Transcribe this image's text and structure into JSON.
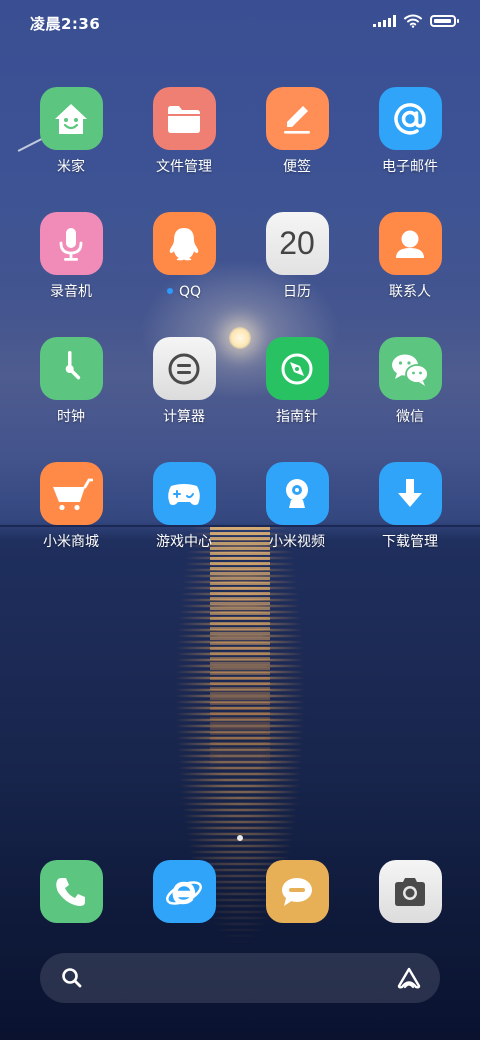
{
  "status_bar": {
    "time": "凌晨2:36",
    "battery_level": 0.95
  },
  "home_screen": {
    "rows": [
      [
        {
          "name": "app-mi-home",
          "label": "米家",
          "color": "#5cc680",
          "icon": "home-smile-icon"
        },
        {
          "name": "app-file-manager",
          "label": "文件管理",
          "color": "#ef7f72",
          "icon": "folder-icon"
        },
        {
          "name": "app-notes",
          "label": "便签",
          "color": "#ff8e57",
          "icon": "pencil-icon"
        },
        {
          "name": "app-email",
          "label": "电子邮件",
          "color": "#2fa4f9",
          "icon": "at-sign-icon"
        }
      ],
      [
        {
          "name": "app-recorder",
          "label": "录音机",
          "color": "#f08cb7",
          "icon": "microphone-icon"
        },
        {
          "name": "app-qq",
          "label": "QQ",
          "color": "#ff8a48",
          "icon": "penguin-icon",
          "notification_dot": true
        },
        {
          "name": "app-calendar",
          "label": "日历",
          "color": "#eeeeee",
          "icon": "calendar-icon",
          "icon_text": "20"
        },
        {
          "name": "app-contacts",
          "label": "联系人",
          "color": "#ff8a48",
          "icon": "person-icon"
        }
      ],
      [
        {
          "name": "app-clock",
          "label": "时钟",
          "color": "#5cc680",
          "icon": "clock-icon"
        },
        {
          "name": "app-calculator",
          "label": "计算器",
          "color": "#ececec",
          "icon": "equals-icon"
        },
        {
          "name": "app-compass",
          "label": "指南针",
          "color": "#28c263",
          "icon": "compass-icon"
        },
        {
          "name": "app-wechat",
          "label": "微信",
          "color": "#5cc680",
          "icon": "chat-bubbles-icon"
        }
      ],
      [
        {
          "name": "app-mi-store",
          "label": "小米商城",
          "color": "#ff8a48",
          "icon": "shopping-cart-icon"
        },
        {
          "name": "app-game-center",
          "label": "游戏中心",
          "color": "#2fa4f9",
          "icon": "gamepad-icon"
        },
        {
          "name": "app-mi-video",
          "label": "小米视频",
          "color": "#2fa4f9",
          "icon": "webcam-icon"
        },
        {
          "name": "app-downloads",
          "label": "下载管理",
          "color": "#2fa4f9",
          "icon": "download-arrow-icon"
        }
      ]
    ],
    "dock": [
      {
        "name": "dock-phone",
        "color": "#5cc680",
        "icon": "phone-icon"
      },
      {
        "name": "dock-browser",
        "color": "#2fa4f9",
        "icon": "browser-e-icon"
      },
      {
        "name": "dock-messages",
        "color": "#e7b057",
        "icon": "message-bubble-icon"
      },
      {
        "name": "dock-camera",
        "color": "#ececec",
        "icon": "camera-icon"
      }
    ]
  },
  "search_bar": {
    "left_icon": "search-icon",
    "right_icon": "assistant-icon"
  }
}
